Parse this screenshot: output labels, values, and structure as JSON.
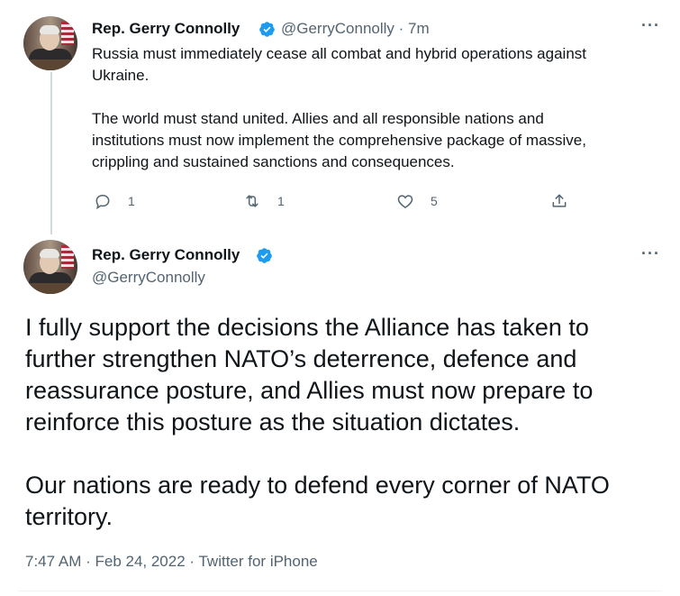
{
  "tweet1": {
    "name": "Rep. Gerry Connolly",
    "handle": "@GerryConnolly",
    "separator": "·",
    "time": "7m",
    "text": "Russia must immediately cease all combat and hybrid operations against\nUkraine.\n\nThe world must stand united. Allies and all responsible nations and\ninstitutions must now implement the comprehensive package of massive,\ncrippling and sustained sanctions and consequences.",
    "reply_count": "1",
    "retweet_count": "1",
    "like_count": "5",
    "more": "···"
  },
  "tweet2": {
    "name": "Rep. Gerry Connolly",
    "handle": "@GerryConnolly",
    "text": "I fully support the decisions the Alliance has taken to\nfurther strengthen NATO’s deterrence, defence and\nreassurance posture, and Allies must now prepare to\nreinforce this posture as the situation dictates.\n\nOur nations are ready to defend every corner of NATO\nterritory.",
    "meta": "7:47 AM · Feb 24, 2022 · Twitter for iPhone",
    "more": "···"
  },
  "icons": {
    "verified": "verified-badge-icon",
    "reply": "reply-icon",
    "retweet": "retweet-icon",
    "like": "heart-icon",
    "share": "share-icon",
    "more": "more-options-icon"
  },
  "colors": {
    "verified_blue": "#1d9bf0",
    "secondary_text": "#536471",
    "primary_text": "#0f1419",
    "thread_line": "#cfd9de"
  }
}
